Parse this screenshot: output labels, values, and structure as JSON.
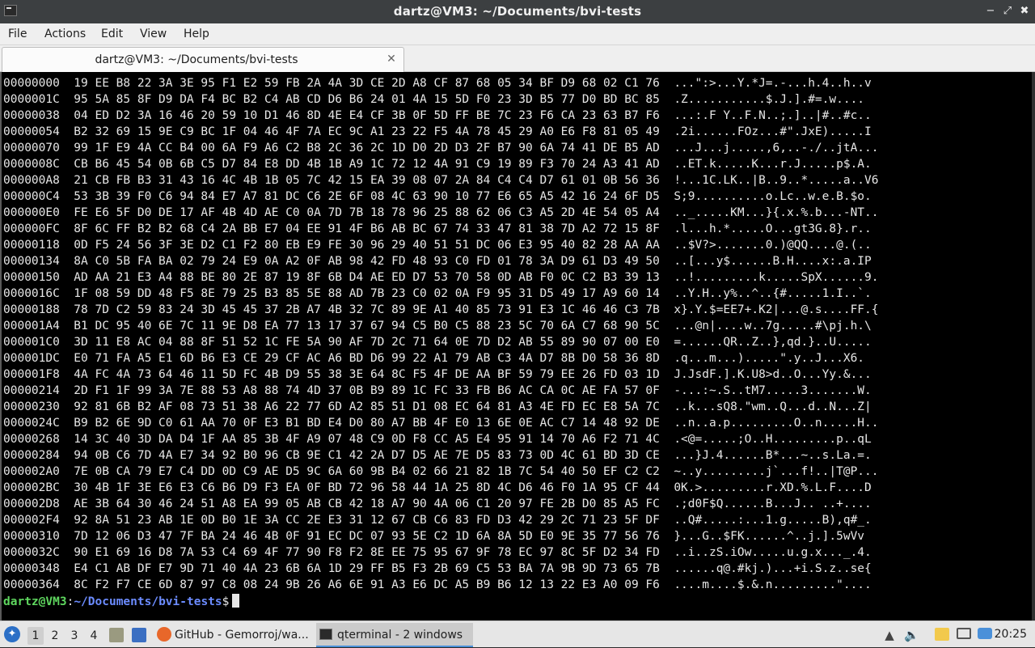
{
  "window": {
    "title": "dartz@VM3: ~/Documents/bvi-tests",
    "minimize_glyph": "−",
    "restore_glyph": "⤢",
    "close_glyph": "✖"
  },
  "menu": {
    "file": "File",
    "actions": "Actions",
    "edit": "Edit",
    "view": "View",
    "help": "Help"
  },
  "tab": {
    "label": "dartz@VM3: ~/Documents/bvi-tests",
    "close_glyph": "✕"
  },
  "terminal": {
    "lines": [
      "00000000  19 EE B8 22 3A 3E 95 F1 E2 59 FB 2A 4A 3D CE 2D A8 CF 87 68 05 34 BF D9 68 02 C1 76  ...\":>...Y.*J=.-...h.4..h..v",
      "0000001C  95 5A 85 8F D9 DA F4 BC B2 C4 AB CD D6 B6 24 01 4A 15 5D F0 23 3D B5 77 D0 BD BC 85  .Z...........$.J.].#=.w....",
      "00000038  04 ED D2 3A 16 46 20 59 10 D1 46 8D 4E E4 CF 3B 0F 5D FF BE 7C 23 F6 CA 23 63 B7 F6  ...:.F Y..F.N..;.]..|#..#c..",
      "00000054  B2 32 69 15 9E C9 BC 1F 04 46 4F 7A EC 9C A1 23 22 F5 4A 78 45 29 A0 E6 F8 81 05 49  .2i......FOz...#\".JxE).....I",
      "00000070  99 1F E9 4A CC B4 00 6A F9 A6 C2 B8 2C 36 2C 1D D0 2D D3 2F B7 90 6A 74 41 DE B5 AD  ...J...j.....,6,..-./..jtA...",
      "0000008C  CB B6 45 54 0B 6B C5 D7 84 E8 DD 4B 1B A9 1C 72 12 4A 91 C9 19 89 F3 70 24 A3 41 AD  ..ET.k.....K...r.J.....p$.A.",
      "000000A8  21 CB FB B3 31 43 16 4C 4B 1B 05 7C 42 15 EA 39 08 07 2A 84 C4 C4 D7 61 01 0B 56 36  !...1C.LK..|B..9..*.....a..V6",
      "000000C4  53 3B 39 F0 C6 94 84 E7 A7 81 DC C6 2E 6F 08 4C 63 90 10 77 E6 65 A5 42 16 24 6F D5  S;9..........o.Lc..w.e.B.$o.",
      "000000E0  FE E6 5F D0 DE 17 AF 4B 4D AE C0 0A 7D 7B 18 78 96 25 88 62 06 C3 A5 2D 4E 54 05 A4  .._.....KM...}{.x.%.b...-NT..",
      "000000FC  8F 6C FF B2 B2 68 C4 2A BB E7 04 EE 91 4F B6 AB BC 67 74 33 47 81 38 7D A2 72 15 8F  .l...h.*.....O...gt3G.8}.r..",
      "00000118  0D F5 24 56 3F 3E D2 C1 F2 80 EB E9 FE 30 96 29 40 51 51 DC 06 E3 95 40 82 28 AA AA  ..$V?>.......0.)@QQ....@.(..",
      "00000134  8A C0 5B FA BA 02 79 24 E9 0A A2 0F AB 98 42 FD 48 93 C0 FD 01 78 3A D9 61 D3 49 50  ..[...y$......B.H....x:.a.IP",
      "00000150  AD AA 21 E3 A4 88 BE 80 2E 87 19 8F 6B D4 AE ED D7 53 70 58 0D AB F0 0C C2 B3 39 13  ..!.........k.....SpX......9.",
      "0000016C  1F 08 59 DD 48 F5 8E 79 25 B3 85 5E 88 AD 7B 23 C0 02 0A F9 95 31 D5 49 17 A9 60 14  ..Y.H..y%..^..{#.....1.I..`.",
      "00000188  78 7D C2 59 83 24 3D 45 45 37 2B A7 4B 32 7C 89 9E A1 40 85 73 91 E3 1C 46 46 C3 7B  x}.Y.$=EE7+.K2|...@.s....FF.{",
      "000001A4  B1 DC 95 40 6E 7C 11 9E D8 EA 77 13 17 37 67 94 C5 B0 C5 88 23 5C 70 6A C7 68 90 5C  ...@n|....w..7g.....#\\pj.h.\\",
      "000001C0  3D 11 E8 AC 04 88 8F 51 52 1C FE 5A 90 AF 7D 2C 71 64 0E 7D D2 AB 55 89 90 07 00 E0  =......QR..Z..},qd.}..U.....",
      "000001DC  E0 71 FA A5 E1 6D B6 E3 CE 29 CF AC A6 BD D6 99 22 A1 79 AB C3 4A D7 8B D0 58 36 8D  .q...m...).....\".y..J...X6.",
      "000001F8  4A FC 4A 73 64 46 11 5D FC 4B D9 55 38 3E 64 8C F5 4F DE AA BF 59 79 EE 26 FD 03 1D  J.JsdF.].K.U8>d..O...Yy.&...",
      "00000214  2D F1 1F 99 3A 7E 88 53 A8 88 74 4D 37 0B B9 89 1C FC 33 FB B6 AC CA 0C AE FA 57 0F  -...:~.S..tM7.....3.......W.",
      "00000230  92 81 6B B2 AF 08 73 51 38 A6 22 77 6D A2 85 51 D1 08 EC 64 81 A3 4E FD EC E8 5A 7C  ..k...sQ8.\"wm..Q...d..N...Z|",
      "0000024C  B9 B2 6E 9D C0 61 AA 70 0F E3 B1 BD E4 D0 80 A7 BB 4F E0 13 6E 0E AC C7 14 48 92 DE  ..n..a.p.........O..n.....H..",
      "00000268  14 3C 40 3D DA D4 1F AA 85 3B 4F A9 07 48 C9 0D F8 CC A5 E4 95 91 14 70 A6 F2 71 4C  .<@=.....;O..H.........p..qL",
      "00000284  94 0B C6 7D 4A E7 34 92 B0 96 CB 9E C1 42 2A D7 D5 AE 7E D5 83 73 0D 4C 61 BD 3D CE  ...}J.4......B*...~..s.La.=.",
      "000002A0  7E 0B CA 79 E7 C4 DD 0D C9 AE D5 9C 6A 60 9B B4 02 66 21 82 1B 7C 54 40 50 EF C2 C2  ~..y.........j`...f!..|T@P...",
      "000002BC  30 4B 1F 3E E6 E3 C6 B6 D9 F3 EA 0F BD 72 96 58 44 1A 25 8D 4C D6 46 F0 1A 95 CF 44  0K.>.........r.XD.%.L.F....D",
      "000002D8  AE 3B 64 30 46 24 51 A8 EA 99 05 AB CB 42 18 A7 90 4A 06 C1 20 97 FE 2B D0 85 A5 FC  .;d0F$Q......B...J.. ..+....",
      "000002F4  92 8A 51 23 AB 1E 0D B0 1E 3A CC 2E E3 31 12 67 CB C6 83 FD D3 42 29 2C 71 23 5F DF  ..Q#.....:...1.g.....B),q#_.",
      "00000310  7D 12 06 D3 47 7F BA 24 46 4B 0F 91 EC DC 07 93 5E C2 1D 6A 8A 5D E0 9E 35 77 56 76  }...G..$FK......^..j.].5wVv",
      "0000032C  90 E1 69 16 D8 7A 53 C4 69 4F 77 90 F8 F2 8E EE 75 95 67 9F 78 EC 97 8C 5F D2 34 FD  ..i..zS.iOw.....u.g.x..._.4.",
      "00000348  E4 C1 AB DF E7 9D 71 40 4A 23 6B 6A 1D 29 FF B5 F3 2B 69 C5 53 BA 7A 9B 9D 73 65 7B  ......q@.#kj.)...+i.S.z..se{",
      "00000364  8C F2 F7 CE 6D 87 97 C8 08 24 9B 26 A6 6E 91 A3 E6 DC A5 B9 B6 12 13 22 E3 A0 09 F6  ....m....$.&.n.........\"...."
    ],
    "prompt_user": "dartz@VM3",
    "prompt_sep": ":",
    "prompt_path": "~/Documents/bvi-tests",
    "prompt_symbol": "$"
  },
  "taskbar": {
    "workspaces": [
      "1",
      "2",
      "3",
      "4"
    ],
    "task_firefox": "GitHub - Gemorroj/wa...",
    "task_terminal": "qterminal - 2 windows",
    "clock": "20:25"
  }
}
